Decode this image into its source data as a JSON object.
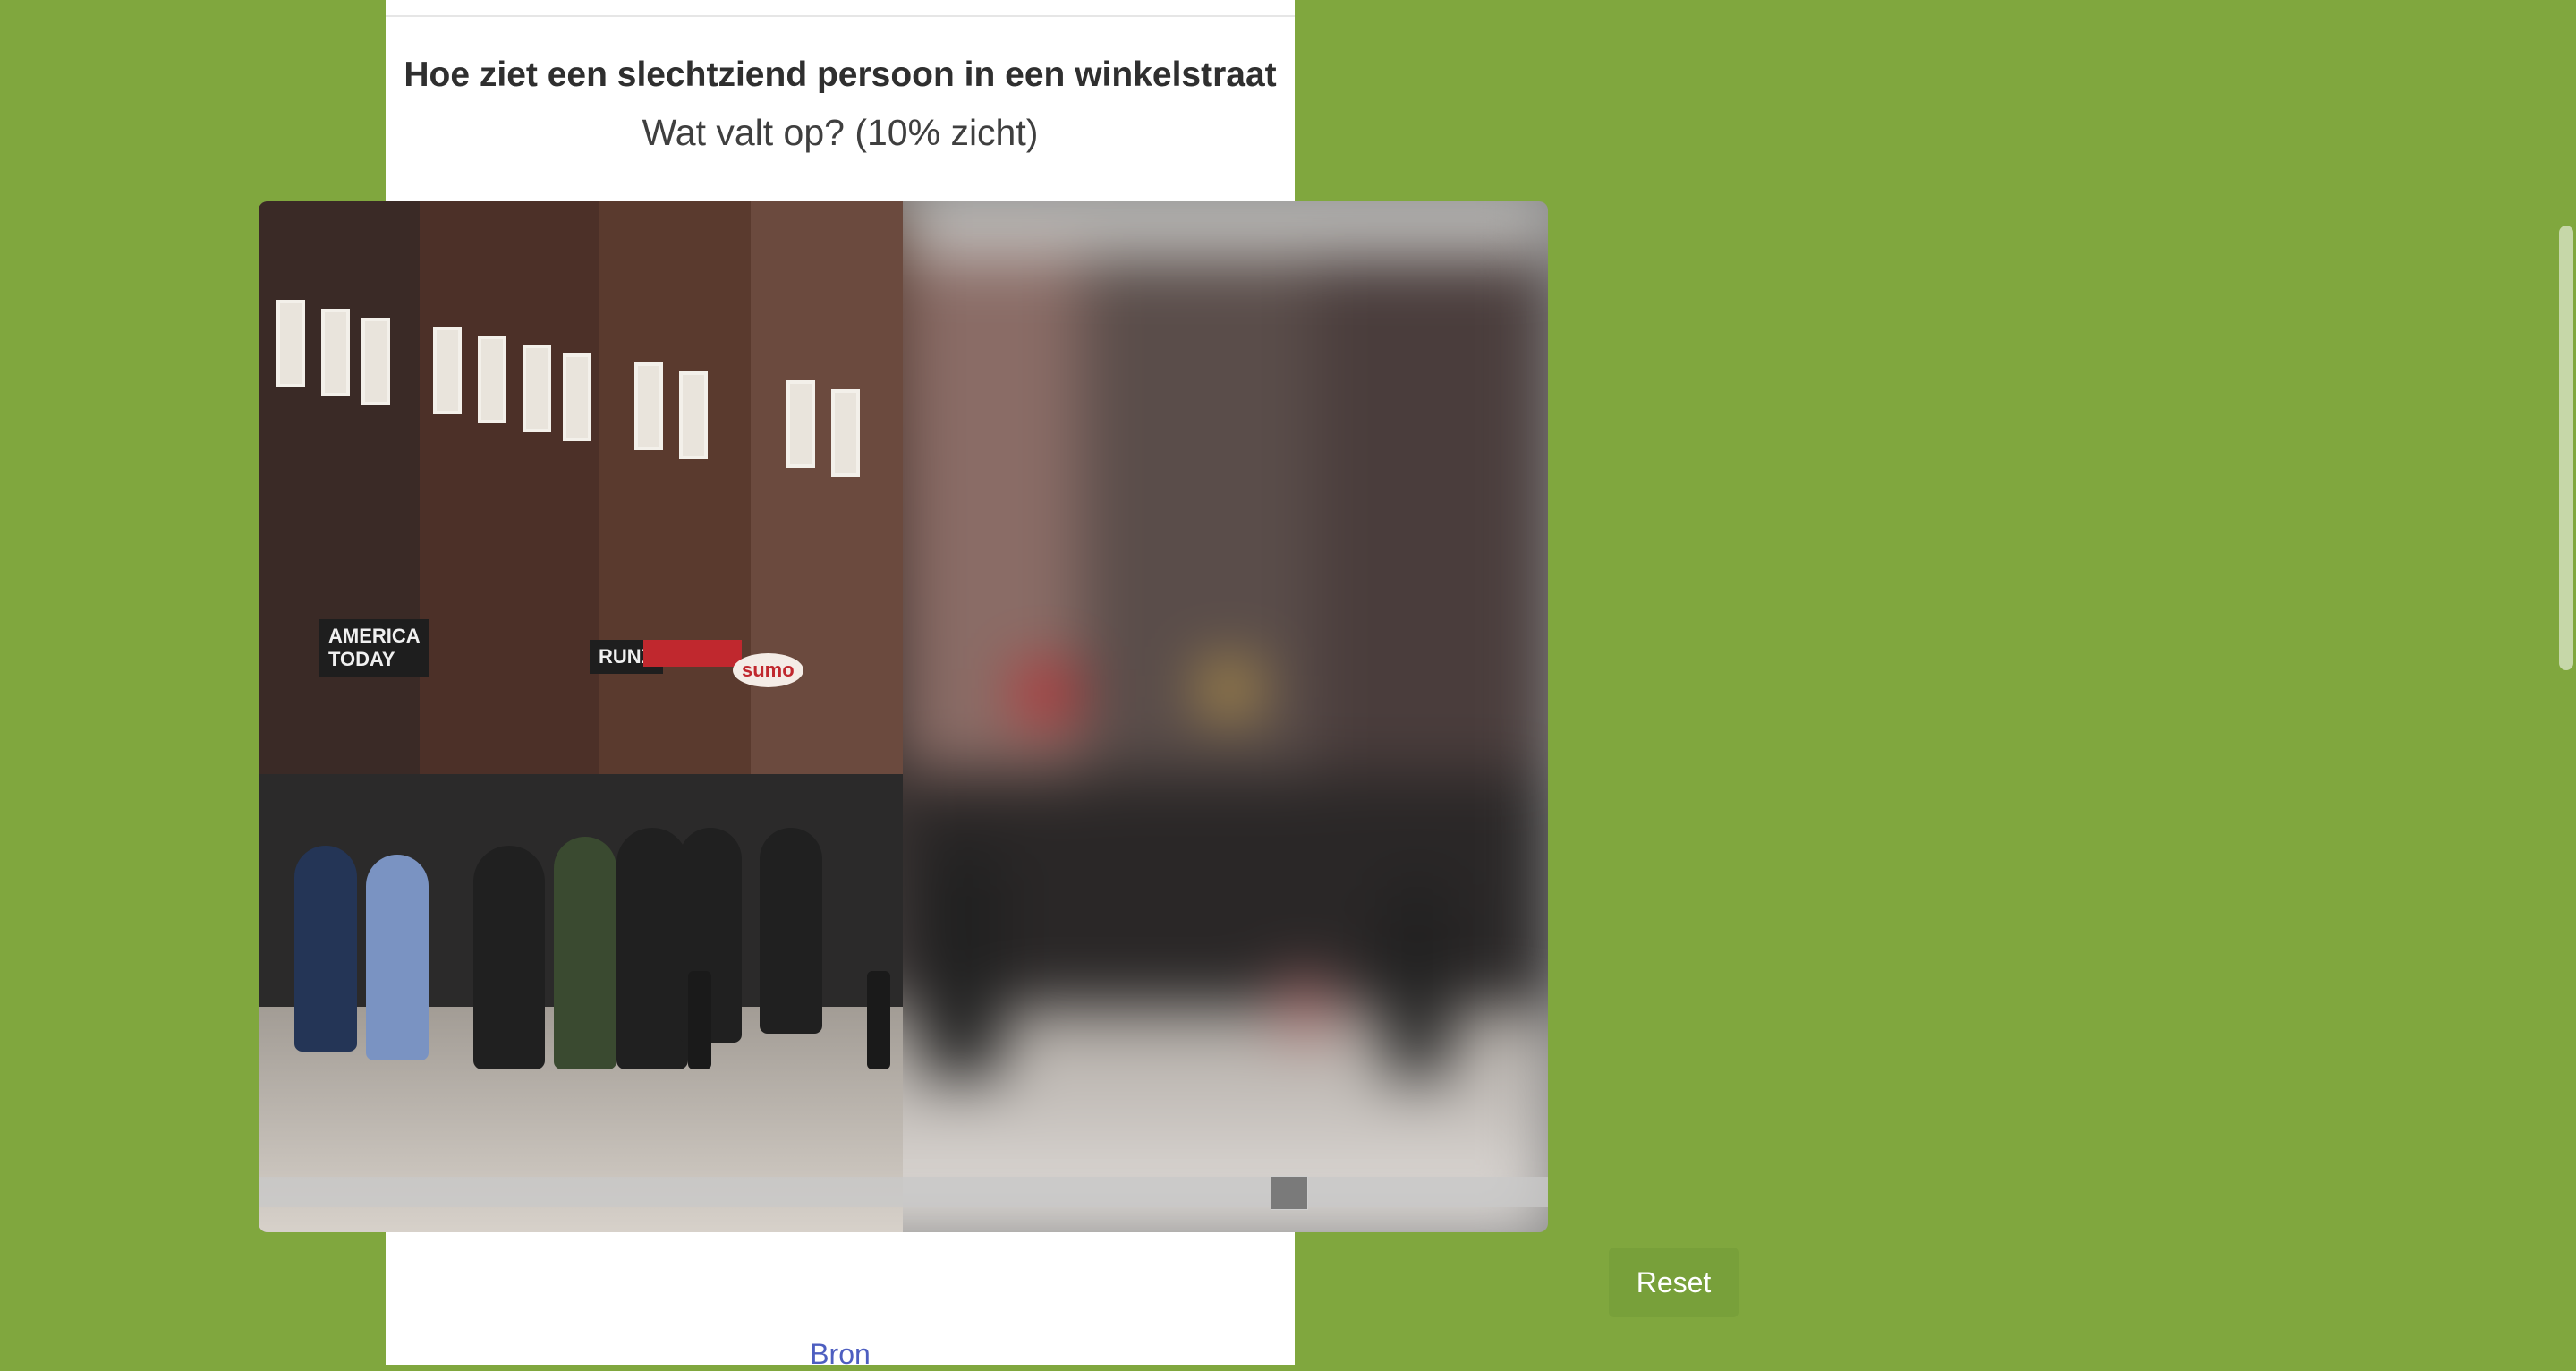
{
  "page": {
    "title": "Hoe ziet een slechtziend persoon in een winkelstraat",
    "subtitle": "Wat valt op? (10% zicht)"
  },
  "comparison": {
    "left_image": "street-scene-clear",
    "right_image": "street-scene-blurred",
    "slider_position": 0.5,
    "signs": {
      "america_line1": "AMERICA",
      "america_line2": "TODAY",
      "runx": "RUNX",
      "sumo": "sumo"
    }
  },
  "actions": {
    "reset_label": "Reset",
    "source_link": "Bron"
  },
  "colors": {
    "background": "#80a73e",
    "button": "#78a03a",
    "link": "#4d5ec0"
  }
}
